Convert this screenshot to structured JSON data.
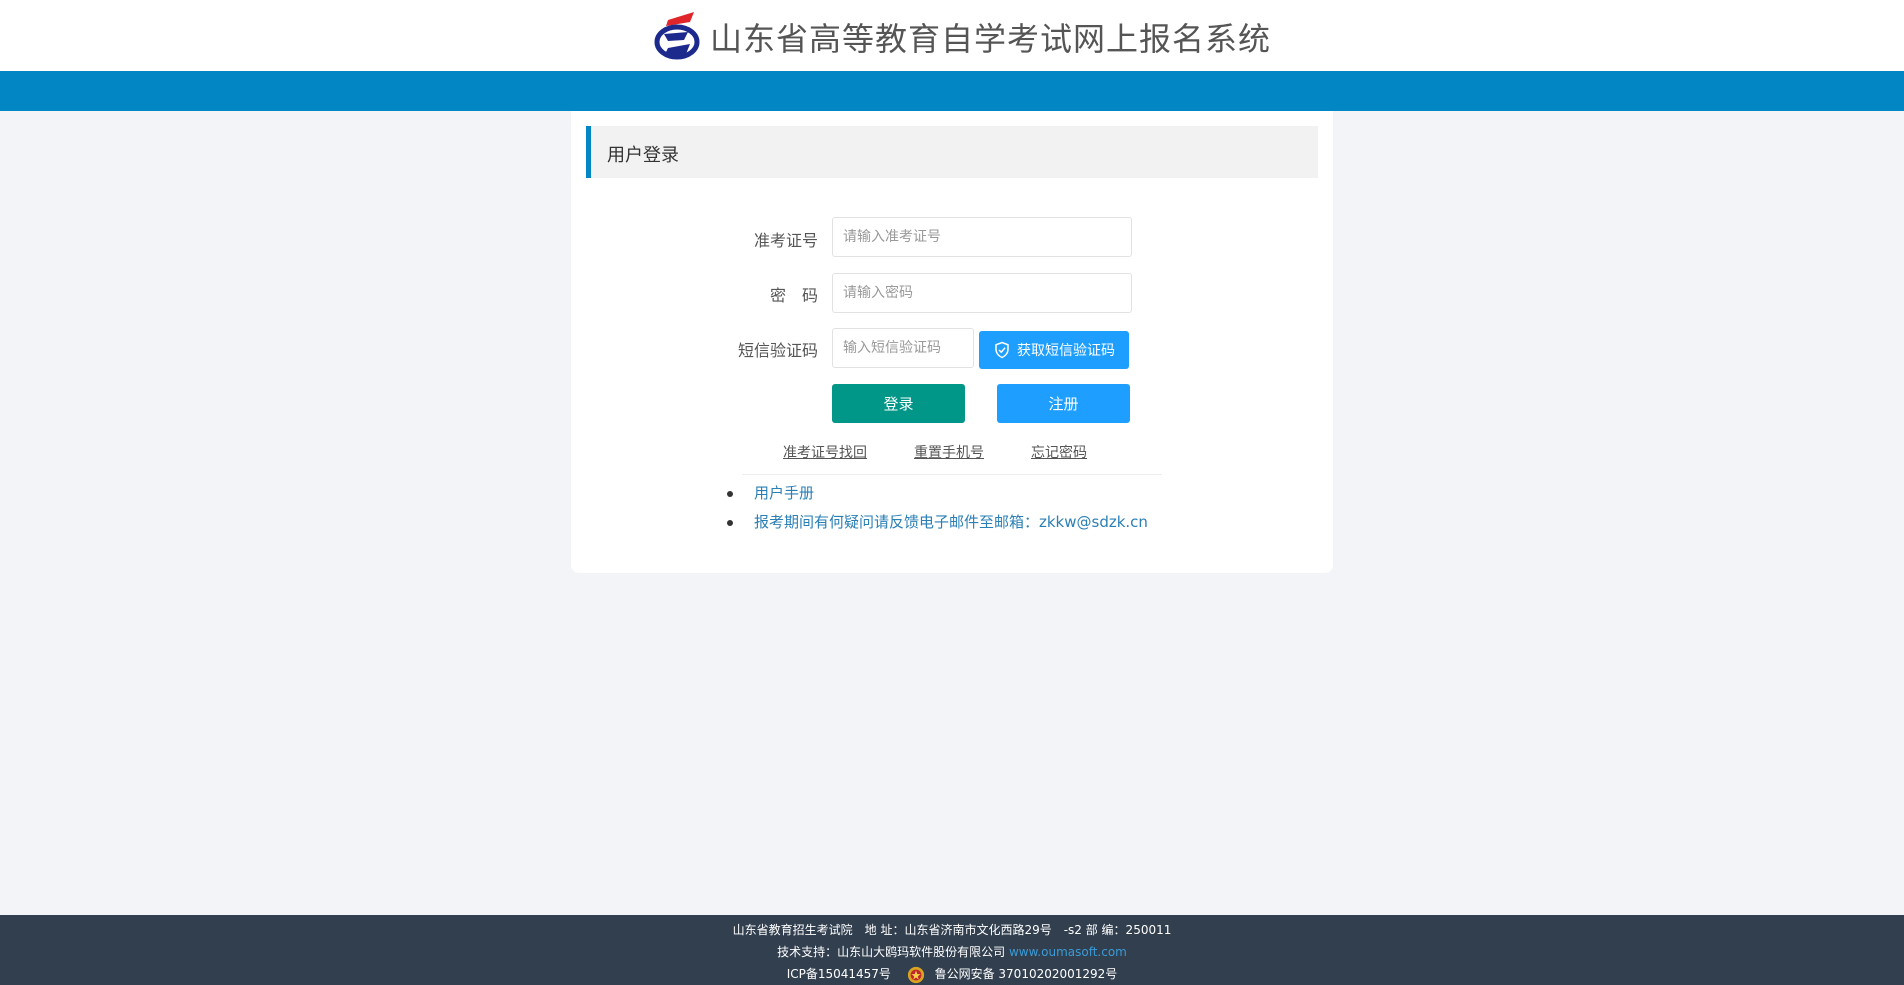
{
  "header": {
    "site_title": "山东省高等教育自学考试网上报名系统",
    "logo_icon": "exam-logo-icon"
  },
  "colors": {
    "brand_blue": "#0387c4",
    "login_green": "#009688",
    "action_blue": "#1e9fff",
    "footer_bg": "#323f4f"
  },
  "login_panel": {
    "title": "用户登录",
    "exam_id_label": "准考证号",
    "exam_id_placeholder": "请输入准考证号",
    "password_label": "密　码",
    "password_placeholder": "请输入密码",
    "sms_label": "短信验证码",
    "sms_placeholder": "输入短信验证码",
    "sms_button": "获取短信验证码",
    "login_button": "登录",
    "register_button": "注册",
    "links": {
      "recover_exam_id": "准考证号找回",
      "reset_phone": "重置手机号",
      "forgot_password": "忘记密码"
    },
    "info": {
      "manual": "用户手册",
      "contact": "报考期间有何疑问请反馈电子邮件至邮箱：zkkw@sdzk.cn"
    }
  },
  "footer": {
    "line1": "山东省教育招生考试院　地 址：山东省济南市文化西路29号　-s2 部 编：250011",
    "support_prefix": "技术支持：山东山大鸥玛软件股份有限公司",
    "support_link": "www.oumasoft.com",
    "icp": "ICP备15041457号",
    "police": "鲁公网安备 37010202001292号"
  }
}
